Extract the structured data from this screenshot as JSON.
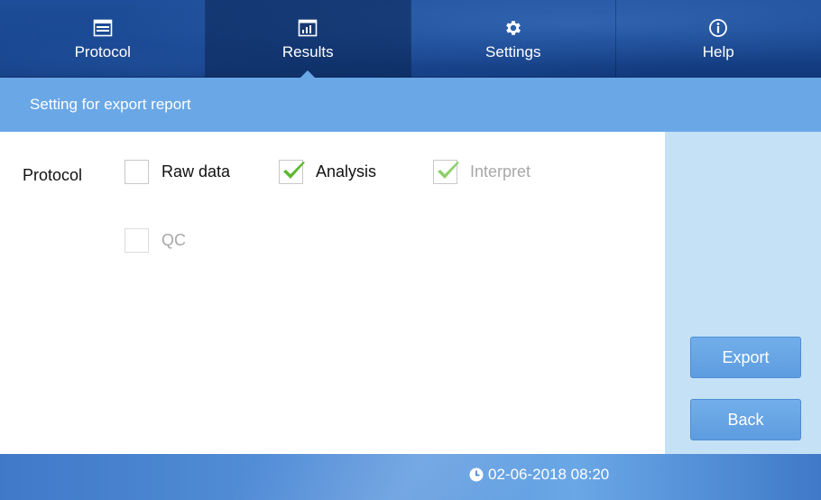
{
  "nav": {
    "tabs": [
      {
        "label": "Protocol",
        "icon": "window-icon",
        "active": false
      },
      {
        "label": "Results",
        "icon": "chart-icon",
        "active": true
      },
      {
        "label": "Settings",
        "icon": "gear-icon",
        "active": false
      },
      {
        "label": "Help",
        "icon": "info-icon",
        "active": false
      }
    ]
  },
  "section": {
    "title": "Setting for export report"
  },
  "form": {
    "row_label": "Protocol",
    "options": [
      {
        "label": "Raw data",
        "checked": false,
        "enabled": true
      },
      {
        "label": "Analysis",
        "checked": true,
        "enabled": true
      },
      {
        "label": "Interpret",
        "checked": true,
        "enabled": false
      },
      {
        "label": "QC",
        "checked": false,
        "enabled": false
      }
    ]
  },
  "actions": {
    "export_label": "Export",
    "back_label": "Back"
  },
  "footer": {
    "datetime": "02-06-2018 08:20",
    "icon": "clock-icon"
  },
  "colors": {
    "nav_bg": "#16428a",
    "accent": "#6aa7e6",
    "side_panel": "#c4e1f6",
    "check_green": "#5cb82e"
  }
}
